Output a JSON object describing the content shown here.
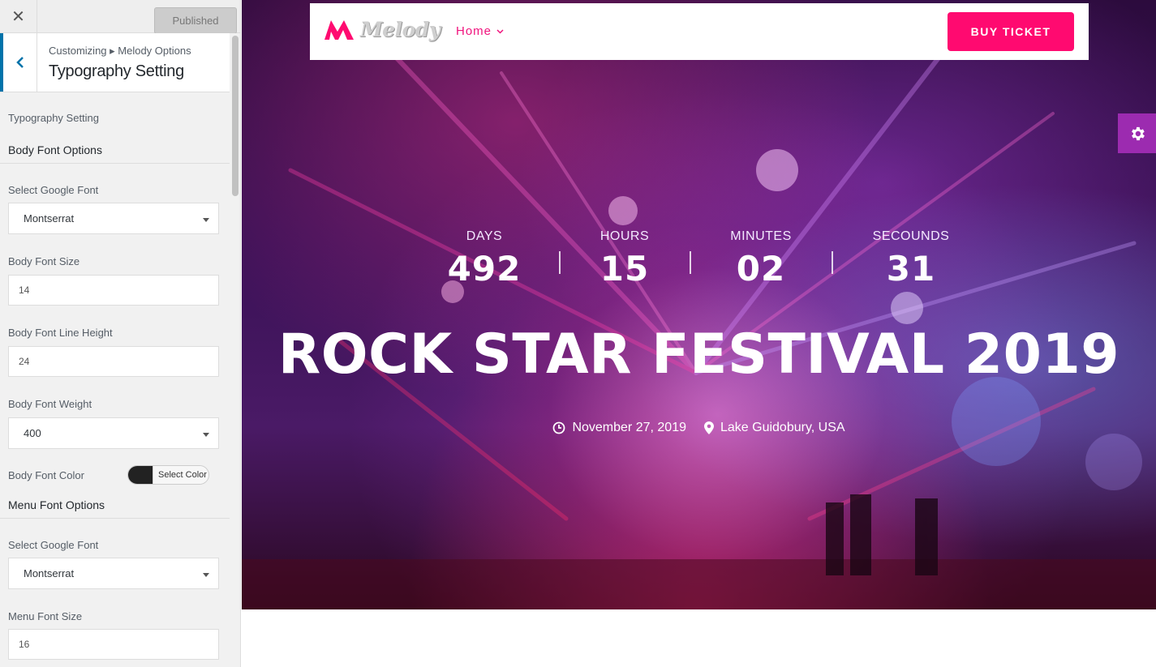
{
  "sidebar": {
    "close_label": "✕",
    "publish_label": "Published",
    "breadcrumb": "Customizing ▸ Melody Options",
    "section_title": "Typography Setting",
    "intro_label": "Typography Setting",
    "body_group": {
      "heading": "Body Font Options",
      "google_font_label": "Select Google Font",
      "google_font_value": "Montserrat",
      "size_label": "Body Font Size",
      "size_value": "14",
      "line_height_label": "Body Font Line Height",
      "line_height_value": "24",
      "weight_label": "Body Font Weight",
      "weight_value": "400",
      "color_label": "Body Font Color",
      "color_button_label": "Select Color",
      "color_value": "#222222"
    },
    "menu_group": {
      "heading": "Menu Font Options",
      "google_font_label": "Select Google Font",
      "google_font_value": "Montserrat",
      "size_label": "Menu Font Size",
      "size_value": "16"
    }
  },
  "preview": {
    "logo_text": "Melody",
    "nav_home": "Home",
    "buy_button": "BUY TICKET",
    "countdown": [
      {
        "label": "DAYS",
        "value": "492"
      },
      {
        "label": "HOURS",
        "value": "15"
      },
      {
        "label": "MINUTES",
        "value": "02"
      },
      {
        "label": "SECOUNDS",
        "value": "31"
      }
    ],
    "title": "ROCK STAR FESTIVAL 2019",
    "date": "November 27, 2019",
    "location": "Lake Guidobury, USA",
    "colors": {
      "accent": "#ff0a70",
      "settings_tab": "#9c2bb0",
      "link": "#0073aa"
    },
    "icons": {
      "settings": "gear-icon",
      "date": "clock-icon",
      "location": "map-pin-icon"
    }
  }
}
